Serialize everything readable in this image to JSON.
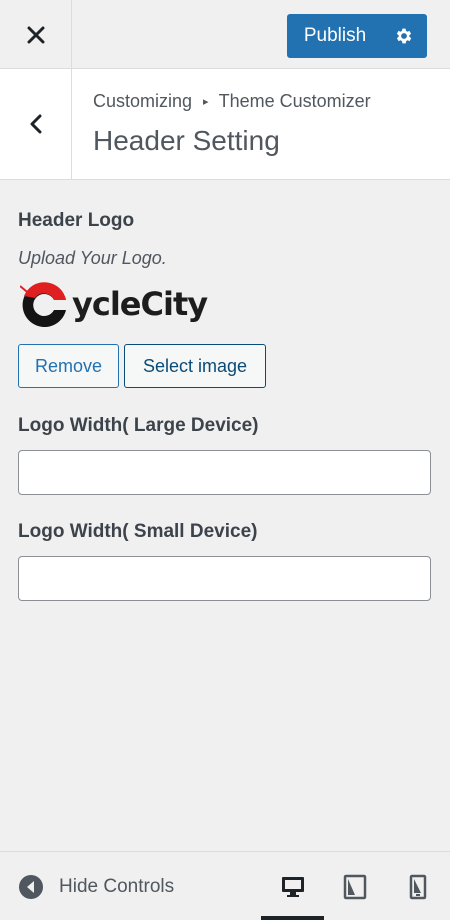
{
  "topbar": {
    "close_icon": "close-icon",
    "publish_label": "Publish",
    "settings_icon": "gear-icon",
    "accent": "#2271b1"
  },
  "section": {
    "breadcrumb_root": "Customizing",
    "breadcrumb_current": "Theme Customizer",
    "title": "Header Setting",
    "back_icon": "chevron-left-icon"
  },
  "controls": {
    "header_logo_label": "Header Logo",
    "header_logo_desc": "Upload Your Logo.",
    "logo_text": "ycleCity",
    "remove_label": "Remove",
    "select_image_label": "Select image",
    "logo_width_large_label": "Logo Width( Large Device)",
    "logo_width_large_value": "",
    "logo_width_small_label": "Logo Width( Small Device)",
    "logo_width_small_value": ""
  },
  "footer": {
    "hide_controls_label": "Hide Controls",
    "devices": [
      {
        "name": "desktop",
        "icon": "desktop-icon",
        "active": true
      },
      {
        "name": "tablet",
        "icon": "tablet-icon",
        "active": false
      },
      {
        "name": "mobile",
        "icon": "mobile-icon",
        "active": false
      }
    ]
  }
}
